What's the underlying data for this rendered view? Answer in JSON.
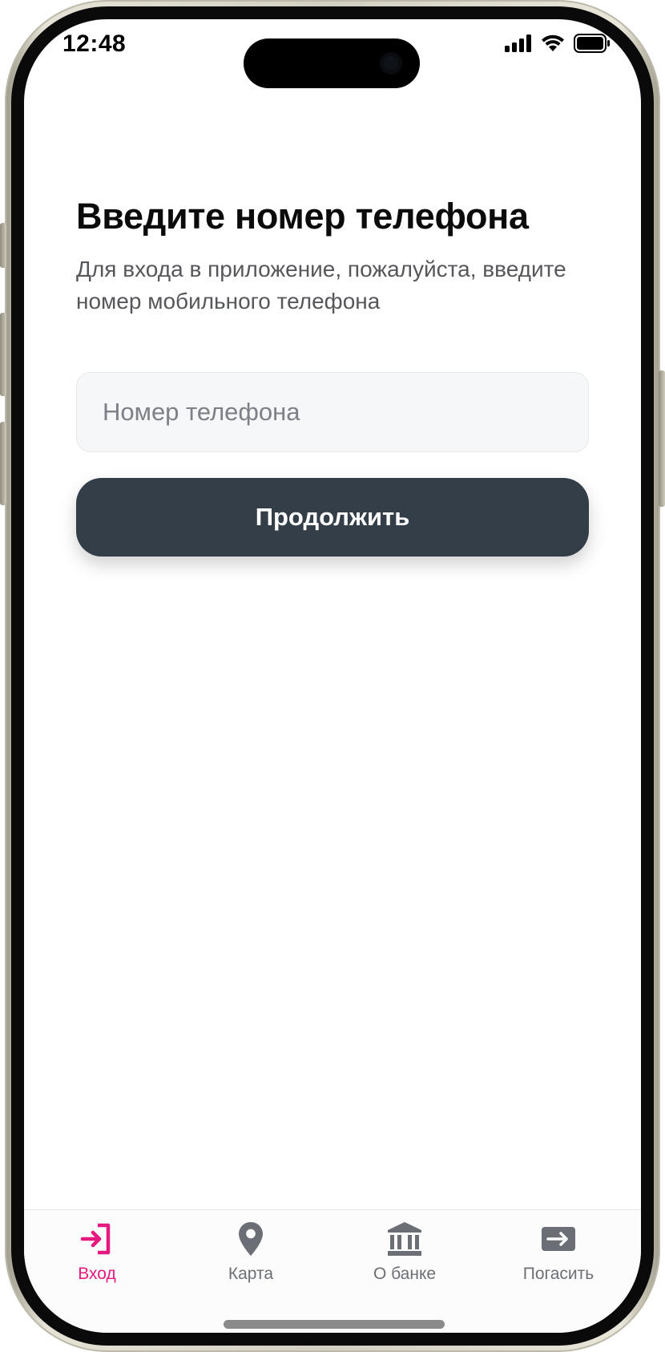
{
  "status_bar": {
    "time": "12:48"
  },
  "login": {
    "title": "Введите номер телефона",
    "subtitle": "Для входа в приложение, пожалуйста, введите номер мобильного телефона",
    "phone_placeholder": "Номер телефона",
    "phone_value": "",
    "continue_label": "Продолжить"
  },
  "tabbar": {
    "active_color": "#e5197f",
    "inactive_color": "#6b6f75",
    "items": [
      {
        "label": "Вход",
        "icon": "login-icon",
        "active": true
      },
      {
        "label": "Карта",
        "icon": "map-pin-icon",
        "active": false
      },
      {
        "label": "О банке",
        "icon": "bank-icon",
        "active": false
      },
      {
        "label": "Погасить",
        "icon": "pay-arrow-icon",
        "active": false
      }
    ]
  },
  "colors": {
    "button_bg": "#333e48",
    "input_bg": "#f6f7f8"
  }
}
